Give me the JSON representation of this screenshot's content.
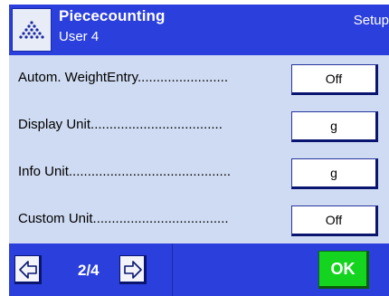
{
  "header": {
    "title": "Piececounting",
    "subtitle": "User 4",
    "setup_label": "Setup",
    "app_icon": "pyramid-dots-icon"
  },
  "settings": [
    {
      "label": "Autom. WeightEntry........................",
      "value": "Off"
    },
    {
      "label": "Display Unit...................................",
      "value": "g"
    },
    {
      "label": "Info Unit...........................................",
      "value": "g"
    },
    {
      "label": "Custom Unit....................................",
      "value": "Off"
    }
  ],
  "footer": {
    "prev_icon": "arrow-left-icon",
    "next_icon": "arrow-right-icon",
    "page_indicator": "2/4",
    "ok_label": "OK"
  },
  "colors": {
    "header_bg": "#2b3fdd",
    "content_bg": "#cfdbf2",
    "ok_bg": "#15d41f"
  }
}
